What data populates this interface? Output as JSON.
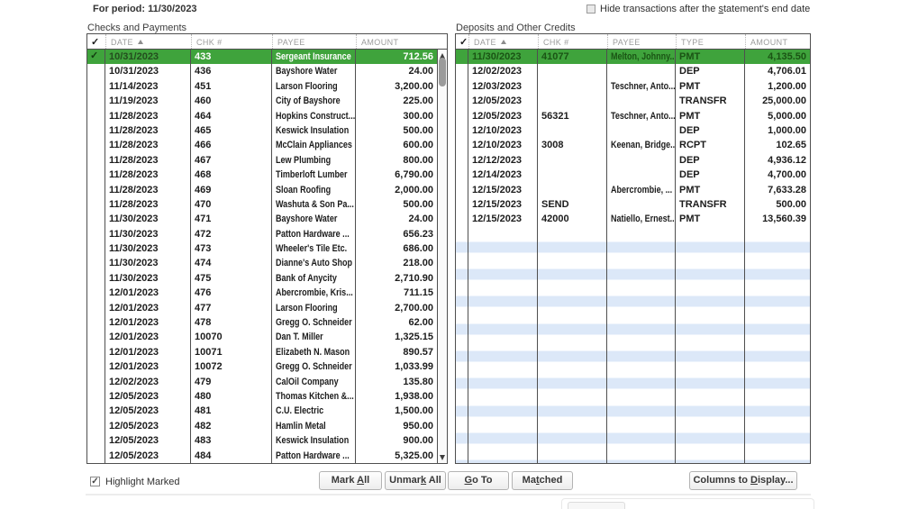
{
  "header": {
    "period_label": "For period: 11/30/2023",
    "hide_checkbox": {
      "label": "Hide transactions after the statement's end date",
      "underline_index": 28,
      "checked": false
    }
  },
  "left_panel": {
    "title": "Checks and Payments",
    "columns": [
      "DATE",
      "CHK #",
      "PAYEE",
      "AMOUNT"
    ],
    "sort_column": "DATE",
    "rows": [
      {
        "checked": true,
        "selected": true,
        "date": "10/31/2023",
        "chk": "433",
        "payee": "Sergeant Insurance",
        "amount": "712.56"
      },
      {
        "checked": false,
        "selected": false,
        "date": "10/31/2023",
        "chk": "436",
        "payee": "Bayshore Water",
        "amount": "24.00"
      },
      {
        "checked": false,
        "selected": false,
        "date": "11/14/2023",
        "chk": "451",
        "payee": "Larson Flooring",
        "amount": "3,200.00"
      },
      {
        "checked": false,
        "selected": false,
        "date": "11/19/2023",
        "chk": "460",
        "payee": "City of Bayshore",
        "amount": "225.00"
      },
      {
        "checked": false,
        "selected": false,
        "date": "11/28/2023",
        "chk": "464",
        "payee": "Hopkins Construct...",
        "amount": "300.00"
      },
      {
        "checked": false,
        "selected": false,
        "date": "11/28/2023",
        "chk": "465",
        "payee": "Keswick Insulation",
        "amount": "500.00"
      },
      {
        "checked": false,
        "selected": false,
        "date": "11/28/2023",
        "chk": "466",
        "payee": "McClain Appliances",
        "amount": "600.00"
      },
      {
        "checked": false,
        "selected": false,
        "date": "11/28/2023",
        "chk": "467",
        "payee": "Lew Plumbing",
        "amount": "800.00"
      },
      {
        "checked": false,
        "selected": false,
        "date": "11/28/2023",
        "chk": "468",
        "payee": "Timberloft Lumber",
        "amount": "6,790.00"
      },
      {
        "checked": false,
        "selected": false,
        "date": "11/28/2023",
        "chk": "469",
        "payee": "Sloan Roofing",
        "amount": "2,000.00"
      },
      {
        "checked": false,
        "selected": false,
        "date": "11/28/2023",
        "chk": "470",
        "payee": "Washuta & Son Pa...",
        "amount": "500.00"
      },
      {
        "checked": false,
        "selected": false,
        "date": "11/30/2023",
        "chk": "471",
        "payee": "Bayshore Water",
        "amount": "24.00"
      },
      {
        "checked": false,
        "selected": false,
        "date": "11/30/2023",
        "chk": "472",
        "payee": "Patton Hardware ...",
        "amount": "656.23"
      },
      {
        "checked": false,
        "selected": false,
        "date": "11/30/2023",
        "chk": "473",
        "payee": "Wheeler's Tile Etc.",
        "amount": "686.00"
      },
      {
        "checked": false,
        "selected": false,
        "date": "11/30/2023",
        "chk": "474",
        "payee": "Dianne's Auto Shop",
        "amount": "218.00"
      },
      {
        "checked": false,
        "selected": false,
        "date": "11/30/2023",
        "chk": "475",
        "payee": "Bank of Anycity",
        "amount": "2,710.90"
      },
      {
        "checked": false,
        "selected": false,
        "date": "12/01/2023",
        "chk": "476",
        "payee": "Abercrombie, Kris...",
        "amount": "711.15"
      },
      {
        "checked": false,
        "selected": false,
        "date": "12/01/2023",
        "chk": "477",
        "payee": "Larson Flooring",
        "amount": "2,700.00"
      },
      {
        "checked": false,
        "selected": false,
        "date": "12/01/2023",
        "chk": "478",
        "payee": "Gregg O. Schneider",
        "amount": "62.00"
      },
      {
        "checked": false,
        "selected": false,
        "date": "12/01/2023",
        "chk": "10070",
        "payee": "Dan T. Miller",
        "amount": "1,325.15"
      },
      {
        "checked": false,
        "selected": false,
        "date": "12/01/2023",
        "chk": "10071",
        "payee": "Elizabeth N. Mason",
        "amount": "890.57"
      },
      {
        "checked": false,
        "selected": false,
        "date": "12/01/2023",
        "chk": "10072",
        "payee": "Gregg O. Schneider",
        "amount": "1,033.99"
      },
      {
        "checked": false,
        "selected": false,
        "date": "12/02/2023",
        "chk": "479",
        "payee": "CalOil Company",
        "amount": "135.80"
      },
      {
        "checked": false,
        "selected": false,
        "date": "12/05/2023",
        "chk": "480",
        "payee": "Thomas Kitchen &...",
        "amount": "1,938.00"
      },
      {
        "checked": false,
        "selected": false,
        "date": "12/05/2023",
        "chk": "481",
        "payee": "C.U. Electric",
        "amount": "1,500.00"
      },
      {
        "checked": false,
        "selected": false,
        "date": "12/05/2023",
        "chk": "482",
        "payee": "Hamlin Metal",
        "amount": "950.00"
      },
      {
        "checked": false,
        "selected": false,
        "date": "12/05/2023",
        "chk": "483",
        "payee": "Keswick Insulation",
        "amount": "900.00"
      },
      {
        "checked": false,
        "selected": false,
        "date": "12/05/2023",
        "chk": "484",
        "payee": "Patton Hardware ...",
        "amount": "5,325.00"
      }
    ]
  },
  "right_panel": {
    "title": "Deposits and Other Credits",
    "columns": [
      "DATE",
      "CHK #",
      "PAYEE",
      "TYPE",
      "AMOUNT"
    ],
    "sort_column": "DATE",
    "empty_row_count": 18,
    "rows": [
      {
        "checked": false,
        "selected": true,
        "date": "11/30/2023",
        "chk": "41077",
        "payee": "Melton, Johnny...",
        "type": "PMT",
        "amount": "4,135.50"
      },
      {
        "checked": false,
        "selected": false,
        "date": "12/02/2023",
        "chk": "",
        "payee": "",
        "type": "DEP",
        "amount": "4,706.01"
      },
      {
        "checked": false,
        "selected": false,
        "date": "12/03/2023",
        "chk": "",
        "payee": "Teschner, Anto...",
        "type": "PMT",
        "amount": "1,200.00"
      },
      {
        "checked": false,
        "selected": false,
        "date": "12/05/2023",
        "chk": "",
        "payee": "",
        "type": "TRANSFR",
        "amount": "25,000.00"
      },
      {
        "checked": false,
        "selected": false,
        "date": "12/05/2023",
        "chk": "56321",
        "payee": "Teschner, Anto...",
        "type": "PMT",
        "amount": "5,000.00"
      },
      {
        "checked": false,
        "selected": false,
        "date": "12/10/2023",
        "chk": "",
        "payee": "",
        "type": "DEP",
        "amount": "1,000.00"
      },
      {
        "checked": false,
        "selected": false,
        "date": "12/10/2023",
        "chk": "3008",
        "payee": "Keenan, Bridge...",
        "type": "RCPT",
        "amount": "102.65"
      },
      {
        "checked": false,
        "selected": false,
        "date": "12/12/2023",
        "chk": "",
        "payee": "",
        "type": "DEP",
        "amount": "4,936.12"
      },
      {
        "checked": false,
        "selected": false,
        "date": "12/14/2023",
        "chk": "",
        "payee": "",
        "type": "DEP",
        "amount": "4,700.00"
      },
      {
        "checked": false,
        "selected": false,
        "date": "12/15/2023",
        "chk": "",
        "payee": "Abercrombie, ...",
        "type": "PMT",
        "amount": "7,633.28"
      },
      {
        "checked": false,
        "selected": false,
        "date": "12/15/2023",
        "chk": "SEND",
        "payee": "",
        "type": "TRANSFR",
        "amount": "500.00"
      },
      {
        "checked": false,
        "selected": false,
        "date": "12/15/2023",
        "chk": "42000",
        "payee": "Natiello, Ernest...",
        "type": "PMT",
        "amount": "13,560.39"
      }
    ]
  },
  "footer": {
    "highlight_marked": {
      "label": "Highlight Marked",
      "checked": true
    },
    "buttons": [
      {
        "label": "Mark All",
        "underline_index": 5
      },
      {
        "label": "Unmark All",
        "underline_index": 5
      },
      {
        "label": "Go To",
        "underline_index": 0
      },
      {
        "label": "Matched",
        "underline_index": 2
      },
      {
        "label": "Columns to Display...",
        "underline_index": 11
      }
    ]
  },
  "colors": {
    "selected_row_bg": "#3fa33c",
    "stripe_blue": "#dce8f8",
    "header_text": "#9b9b9b"
  }
}
